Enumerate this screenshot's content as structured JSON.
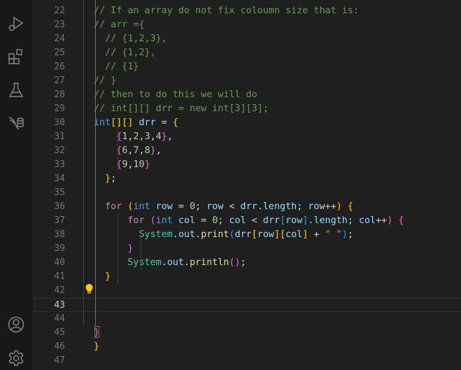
{
  "activity_bar": {
    "icons": [
      "run-debug-icon",
      "extensions-icon",
      "testing-icon",
      "database-icon",
      "account-icon",
      "settings-gear-icon"
    ]
  },
  "editor": {
    "current_line": "43",
    "lines": [
      {
        "n": "22",
        "tokens": [
          {
            "t": "// If an array do not fix coloumn size that is:",
            "c": "cm"
          }
        ]
      },
      {
        "n": "23",
        "tokens": [
          {
            "t": "// arr ={",
            "c": "cm"
          }
        ]
      },
      {
        "n": "24",
        "tokens": [
          {
            "t": "  // {1,2,3},",
            "c": "cm"
          }
        ]
      },
      {
        "n": "25",
        "tokens": [
          {
            "t": "  // {1,2},",
            "c": "cm"
          }
        ]
      },
      {
        "n": "26",
        "tokens": [
          {
            "t": "  // {1}",
            "c": "cm"
          }
        ]
      },
      {
        "n": "27",
        "tokens": [
          {
            "t": "// }",
            "c": "cm"
          }
        ]
      },
      {
        "n": "28",
        "tokens": [
          {
            "t": "// then to do this we will do",
            "c": "cm"
          }
        ]
      },
      {
        "n": "29",
        "tokens": [
          {
            "t": "// int[][] drr = new int[3][3];",
            "c": "cm"
          }
        ]
      },
      {
        "n": "30",
        "tokens": [
          {
            "t": "int",
            "c": "kw"
          },
          {
            "t": "[][]",
            "c": "b1"
          },
          {
            "t": " drr",
            "c": "v"
          },
          {
            "t": " = ",
            "c": "op"
          },
          {
            "t": "{",
            "c": "b1"
          }
        ]
      },
      {
        "n": "31",
        "tokens": [
          {
            "t": "    ",
            "c": "op"
          },
          {
            "t": "{",
            "c": "b2"
          },
          {
            "t": "1",
            "c": "num"
          },
          {
            "t": ",",
            "c": "op"
          },
          {
            "t": "2",
            "c": "num"
          },
          {
            "t": ",",
            "c": "op"
          },
          {
            "t": "3",
            "c": "num"
          },
          {
            "t": ",",
            "c": "op"
          },
          {
            "t": "4",
            "c": "num"
          },
          {
            "t": "}",
            "c": "b2"
          },
          {
            "t": ",",
            "c": "op"
          }
        ]
      },
      {
        "n": "32",
        "tokens": [
          {
            "t": "    ",
            "c": "op"
          },
          {
            "t": "{",
            "c": "b2"
          },
          {
            "t": "6",
            "c": "num"
          },
          {
            "t": ",",
            "c": "op"
          },
          {
            "t": "7",
            "c": "num"
          },
          {
            "t": ",",
            "c": "op"
          },
          {
            "t": "8",
            "c": "num"
          },
          {
            "t": "}",
            "c": "b2"
          },
          {
            "t": ",",
            "c": "op"
          }
        ]
      },
      {
        "n": "33",
        "tokens": [
          {
            "t": "    ",
            "c": "op"
          },
          {
            "t": "{",
            "c": "b2"
          },
          {
            "t": "9",
            "c": "num"
          },
          {
            "t": ",",
            "c": "op"
          },
          {
            "t": "10",
            "c": "num"
          },
          {
            "t": "}",
            "c": "b2"
          }
        ]
      },
      {
        "n": "34",
        "tokens": [
          {
            "t": "  ",
            "c": "op"
          },
          {
            "t": "}",
            "c": "b1"
          },
          {
            "t": ";",
            "c": "op"
          }
        ]
      },
      {
        "n": "35",
        "tokens": []
      },
      {
        "n": "36",
        "tokens": [
          {
            "t": "  ",
            "c": "op"
          },
          {
            "t": "for",
            "c": "ctl"
          },
          {
            "t": " ",
            "c": "op"
          },
          {
            "t": "(",
            "c": "b1"
          },
          {
            "t": "int",
            "c": "kw"
          },
          {
            "t": " row",
            "c": "v"
          },
          {
            "t": " = ",
            "c": "op"
          },
          {
            "t": "0",
            "c": "num"
          },
          {
            "t": "; ",
            "c": "op"
          },
          {
            "t": "row",
            "c": "v"
          },
          {
            "t": " < ",
            "c": "op"
          },
          {
            "t": "drr",
            "c": "v"
          },
          {
            "t": ".",
            "c": "op"
          },
          {
            "t": "length",
            "c": "v"
          },
          {
            "t": "; ",
            "c": "op"
          },
          {
            "t": "row",
            "c": "v"
          },
          {
            "t": "++",
            "c": "op"
          },
          {
            "t": ")",
            "c": "b1"
          },
          {
            "t": " ",
            "c": "op"
          },
          {
            "t": "{",
            "c": "b1"
          }
        ]
      },
      {
        "n": "37",
        "tokens": [
          {
            "t": "      ",
            "c": "op"
          },
          {
            "t": "for",
            "c": "ctl"
          },
          {
            "t": " ",
            "c": "op"
          },
          {
            "t": "(",
            "c": "b2"
          },
          {
            "t": "int",
            "c": "kw"
          },
          {
            "t": " col",
            "c": "v"
          },
          {
            "t": " = ",
            "c": "op"
          },
          {
            "t": "0",
            "c": "num"
          },
          {
            "t": "; ",
            "c": "op"
          },
          {
            "t": "col",
            "c": "v"
          },
          {
            "t": " < ",
            "c": "op"
          },
          {
            "t": "drr",
            "c": "v"
          },
          {
            "t": "[",
            "c": "b3"
          },
          {
            "t": "row",
            "c": "v"
          },
          {
            "t": "]",
            "c": "b3"
          },
          {
            "t": ".",
            "c": "op"
          },
          {
            "t": "length",
            "c": "v"
          },
          {
            "t": "; ",
            "c": "op"
          },
          {
            "t": "col",
            "c": "v"
          },
          {
            "t": "++",
            "c": "op"
          },
          {
            "t": ")",
            "c": "b2"
          },
          {
            "t": " ",
            "c": "op"
          },
          {
            "t": "{",
            "c": "b2"
          }
        ]
      },
      {
        "n": "38",
        "tokens": [
          {
            "t": "        ",
            "c": "op"
          },
          {
            "t": "System",
            "c": "cls"
          },
          {
            "t": ".",
            "c": "op"
          },
          {
            "t": "out",
            "c": "v"
          },
          {
            "t": ".",
            "c": "op"
          },
          {
            "t": "print",
            "c": "fn"
          },
          {
            "t": "(",
            "c": "b3"
          },
          {
            "t": "drr",
            "c": "v"
          },
          {
            "t": "[",
            "c": "b1"
          },
          {
            "t": "row",
            "c": "v"
          },
          {
            "t": "]",
            "c": "b1"
          },
          {
            "t": "[",
            "c": "b1"
          },
          {
            "t": "col",
            "c": "v"
          },
          {
            "t": "]",
            "c": "b1"
          },
          {
            "t": " + ",
            "c": "op"
          },
          {
            "t": "\" \"",
            "c": "str"
          },
          {
            "t": ")",
            "c": "b3"
          },
          {
            "t": ";",
            "c": "op"
          }
        ]
      },
      {
        "n": "39",
        "tokens": [
          {
            "t": "      ",
            "c": "op"
          },
          {
            "t": "}",
            "c": "b2"
          }
        ]
      },
      {
        "n": "40",
        "tokens": [
          {
            "t": "      ",
            "c": "op"
          },
          {
            "t": "System",
            "c": "cls"
          },
          {
            "t": ".",
            "c": "op"
          },
          {
            "t": "out",
            "c": "v"
          },
          {
            "t": ".",
            "c": "op"
          },
          {
            "t": "println",
            "c": "fn"
          },
          {
            "t": "()",
            "c": "b2"
          },
          {
            "t": ";",
            "c": "op"
          }
        ]
      },
      {
        "n": "41",
        "tokens": [
          {
            "t": "  ",
            "c": "op"
          },
          {
            "t": "}",
            "c": "b1"
          }
        ]
      },
      {
        "n": "42",
        "tokens": []
      },
      {
        "n": "43",
        "tokens": []
      },
      {
        "n": "44",
        "tokens": []
      },
      {
        "n": "45",
        "tokens": [
          {
            "t": "}",
            "c": "b2"
          }
        ]
      },
      {
        "n": "46",
        "tokens": [
          {
            "t": "}",
            "c": "b1"
          }
        ]
      },
      {
        "n": "47",
        "tokens": []
      }
    ]
  }
}
